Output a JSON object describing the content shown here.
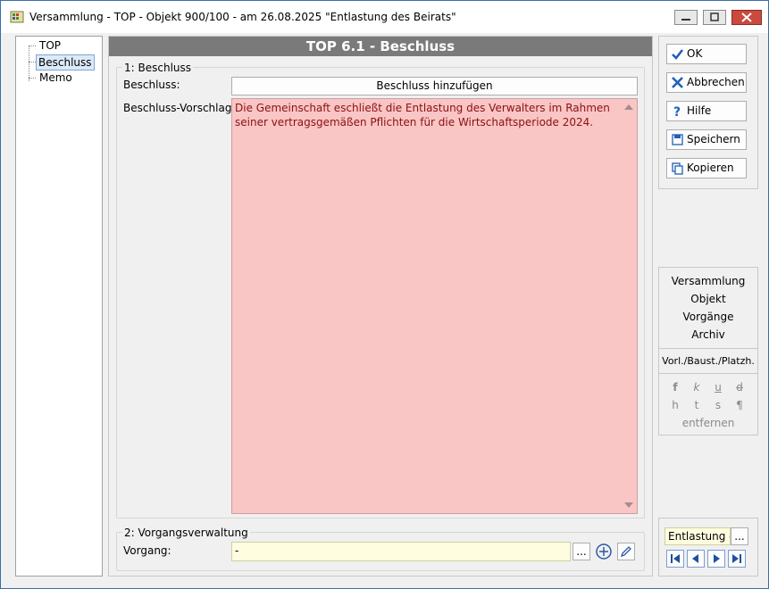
{
  "window": {
    "title": "Versammlung - TOP - Objekt 900/100 - am 26.08.2025 \"Entlastung des Beirats\""
  },
  "tree": {
    "items": [
      {
        "label": "TOP",
        "selected": false
      },
      {
        "label": "Beschluss",
        "selected": true
      },
      {
        "label": "Memo",
        "selected": false
      }
    ]
  },
  "main": {
    "header": "TOP 6.1 - Beschluss",
    "group1_title": "1: Beschluss",
    "beschluss_label": "Beschluss:",
    "add_button": "Beschluss hinzufügen",
    "vorschlag_label": "Beschluss-Vorschlag:",
    "vorschlag_text": "Die Gemeinschaft eschließt die Entlastung des Verwalters im Rahmen seiner vertragsgemäßen Pflichten für die Wirtschaftsperiode 2024.",
    "group2_title": "2: Vorgangsverwaltung",
    "vorgang_label": "Vorgang:",
    "vorgang_value": "-",
    "browse_label": "...",
    "textarea_color": "#fac5c5",
    "input_color": "#fffde0"
  },
  "actions": {
    "ok": "OK",
    "cancel": "Abbrechen",
    "help": "Hilfe",
    "save": "Speichern",
    "copy": "Kopieren"
  },
  "links": {
    "items": [
      "Versammlung",
      "Objekt",
      "Vorgänge",
      "Archiv"
    ],
    "vorl": "Vorl./Baust./Platzh."
  },
  "format": {
    "row1": [
      "f",
      "k",
      "u",
      "d"
    ],
    "row2": [
      "h",
      "t",
      "s",
      "¶"
    ],
    "remove": "entfernen"
  },
  "footer": {
    "field_value": "Entlastung d",
    "browse_label": "..."
  },
  "icons": {
    "ok": "checkmark-icon",
    "cancel": "x-icon",
    "help": "question-icon",
    "save": "save-icon",
    "copy": "copy-icon"
  }
}
